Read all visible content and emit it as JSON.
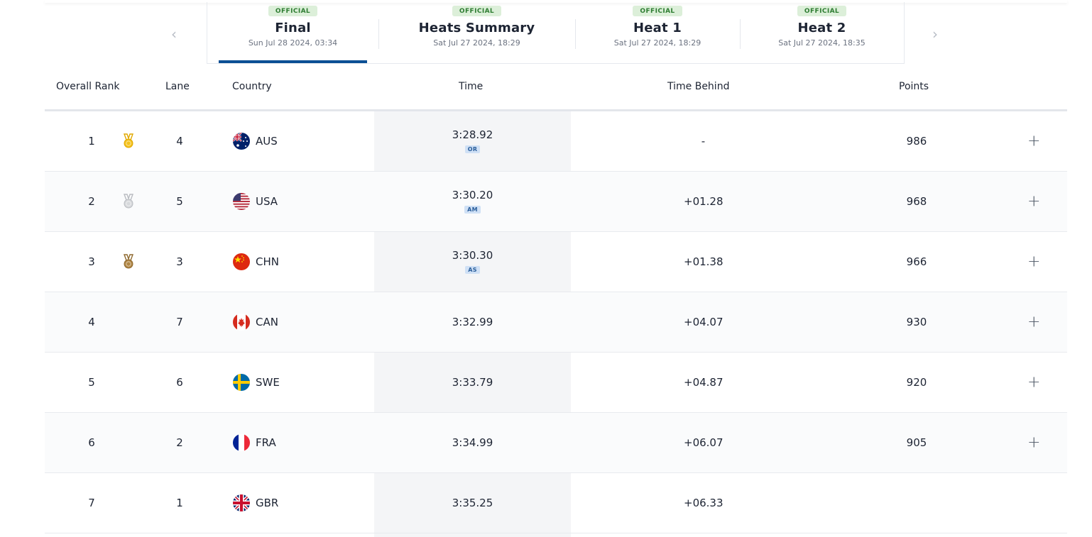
{
  "tabs": [
    {
      "badge": "OFFICIAL",
      "name": "Final",
      "date": "Sun Jul 28 2024, 03:34",
      "active": true
    },
    {
      "badge": "OFFICIAL",
      "name": "Heats Summary",
      "date": "Sat Jul 27 2024, 18:29"
    },
    {
      "badge": "OFFICIAL",
      "name": "Heat 1",
      "date": "Sat Jul 27 2024, 18:29"
    },
    {
      "badge": "OFFICIAL",
      "name": "Heat 2",
      "date": "Sat Jul 27 2024, 18:35"
    }
  ],
  "nav": {
    "prev": "‹",
    "next": "›"
  },
  "columns": {
    "rank": "Overall Rank",
    "lane": "Lane",
    "country": "Country",
    "time": "Time",
    "behind": "Time Behind",
    "points": "Points"
  },
  "rows": [
    {
      "rank": "1",
      "medal": "gold-medal-icon",
      "lane": "4",
      "country": "AUS",
      "time": "3:28.92",
      "record": "OR",
      "behind": "-",
      "points": "986"
    },
    {
      "rank": "2",
      "medal": "silver-medal-icon",
      "lane": "5",
      "country": "USA",
      "time": "3:30.20",
      "record": "AM",
      "behind": "+01.28",
      "points": "968"
    },
    {
      "rank": "3",
      "medal": "bronze-medal-icon",
      "lane": "3",
      "country": "CHN",
      "time": "3:30.30",
      "record": "AS",
      "behind": "+01.38",
      "points": "966"
    },
    {
      "rank": "4",
      "lane": "7",
      "country": "CAN",
      "time": "3:32.99",
      "behind": "+04.07",
      "points": "930"
    },
    {
      "rank": "5",
      "lane": "6",
      "country": "SWE",
      "time": "3:33.79",
      "behind": "+04.87",
      "points": "920"
    },
    {
      "rank": "6",
      "lane": "2",
      "country": "FRA",
      "time": "3:34.99",
      "behind": "+06.07",
      "points": "905"
    },
    {
      "rank": "7",
      "lane": "1",
      "country": "GBR",
      "time": "3:35.25",
      "behind": "+06.33",
      "points": ""
    }
  ],
  "expand_glyph": "+",
  "colors": {
    "accent": "#0b4f94",
    "official_bg": "#dcefd9",
    "official_text": "#2e7d32",
    "record_bg": "#cfe0f5"
  }
}
